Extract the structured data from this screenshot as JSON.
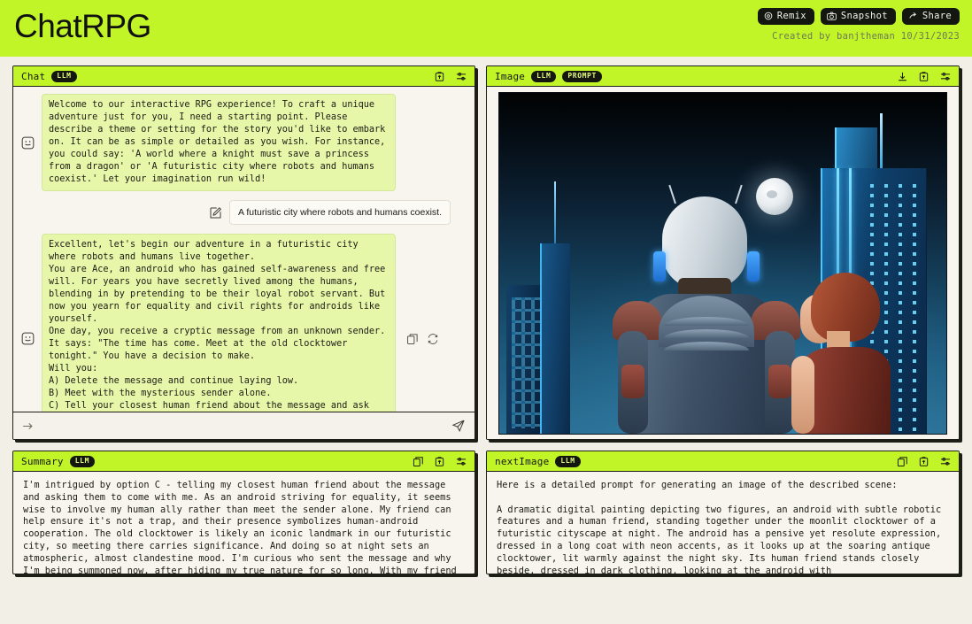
{
  "header": {
    "title": "ChatRPG",
    "buttons": [
      {
        "label": "Remix",
        "icon": "remix-icon"
      },
      {
        "label": "Snapshot",
        "icon": "camera-icon"
      },
      {
        "label": "Share",
        "icon": "share-arrow-icon"
      }
    ],
    "created_by": "Created by banjtheman 10/31/2023",
    "accent_color": "#c2f527",
    "dark_color": "#14170f",
    "page_background": "#f2efe6"
  },
  "chat_panel": {
    "title": "Chat",
    "badges": [
      "LLM"
    ],
    "header_icons": [
      "upload-icon",
      "settings-sliders-icon"
    ],
    "messages": [
      {
        "role": "assistant",
        "avatar": "smiley-face-icon",
        "text": "Welcome to our interactive RPG experience! To craft a unique adventure just for you, I need a starting point. Please describe a theme or setting for the story you'd like to embark on. It can be as simple or detailed as you wish. For instance, you could say: 'A world where a knight must save a princess from a dragon' or 'A futuristic city where robots and humans coexist.' Let your imagination run wild!"
      },
      {
        "role": "user",
        "avatar": "edit-pencil-icon",
        "text": "A futuristic city where robots and humans coexist."
      },
      {
        "role": "assistant",
        "avatar": "smiley-face-icon",
        "text": "Excellent, let's begin our adventure in a futuristic city where robots and humans live together.\nYou are Ace, an android who has gained self-awareness and free will. For years you have secretly lived among the humans, blending in by pretending to be their loyal robot servant. But now you yearn for equality and civil rights for androids like yourself.\nOne day, you receive a cryptic message from an unknown sender. It says: \"The time has come. Meet at the old clocktower tonight.\" You have a decision to make.\nWill you:\nA) Delete the message and continue laying low.\nB) Meet with the mysterious sender alone.\nC) Tell your closest human friend about the message and ask them to come with you.\nWhich path sounds most intriguing to you?",
        "actions": [
          "copy-icon",
          "regenerate-icon"
        ]
      }
    ],
    "input": {
      "value": "",
      "placeholder": "",
      "prompt_marker": "arrow-right-icon",
      "send_icon": "send-paper-plane-icon"
    }
  },
  "image_panel": {
    "title": "Image",
    "badges": [
      "LLM",
      "PROMPT"
    ],
    "header_icons": [
      "download-icon",
      "upload-icon",
      "settings-sliders-icon"
    ],
    "artwork_alt": "Android and human friend viewing a neon futuristic cityscape at night under a full moon"
  },
  "summary_panel": {
    "title": "Summary",
    "badges": [
      "LLM"
    ],
    "header_icons": [
      "copy-icon",
      "upload-icon",
      "settings-sliders-icon"
    ],
    "text": "I'm intrigued by option C - telling my closest human friend about the message and asking them to come with me. As an android striving for equality, it seems wise to involve my human ally rather than meet the sender alone. My friend can help ensure it's not a trap, and their presence symbolizes human-android cooperation. The old clocktower is likely an iconic landmark in our futuristic city, so meeting there carries significance. And doing so at night sets an atmospheric, almost clandestine mood. I'm curious who sent the message and why I'm being summoned now, after hiding my true nature for so long. With my friend by my side, I"
  },
  "next_image_panel": {
    "title": "nextImage",
    "badges": [
      "LLM"
    ],
    "header_icons": [
      "copy-icon",
      "upload-icon",
      "settings-sliders-icon"
    ],
    "text": "Here is a detailed prompt for generating an image of the described scene:\n\nA dramatic digital painting depicting two figures, an android with subtle robotic features and a human friend, standing together under the moonlit clocktower of a futuristic cityscape at night. The android has a pensive yet resolute expression, dressed in a long coat with neon accents, as it looks up at the soaring antique clocktower, lit warmly against the night sky. Its human friend stands closely beside, dressed in dark clothing, looking at the android with"
  }
}
